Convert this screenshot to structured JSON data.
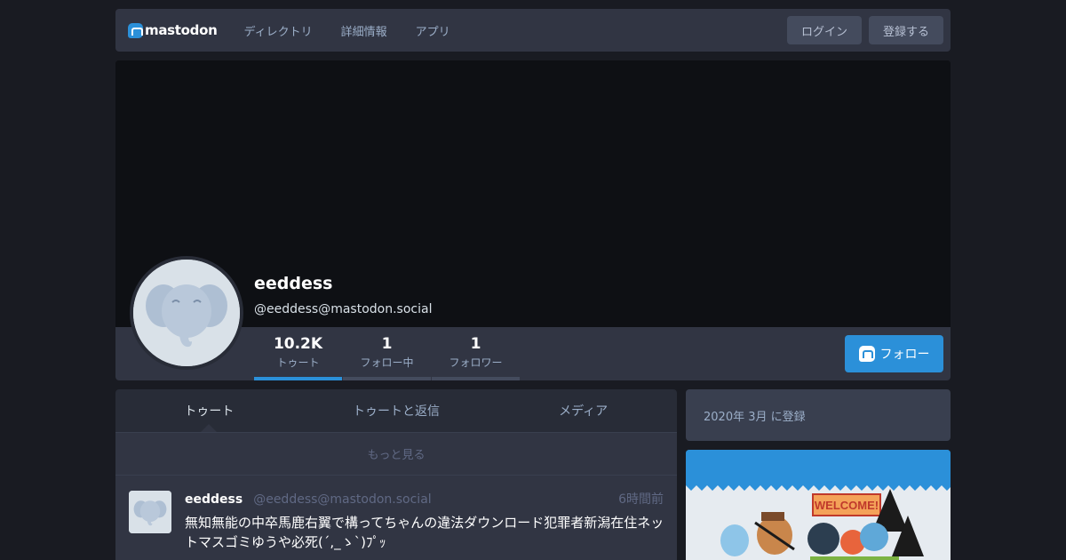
{
  "nav": {
    "logo_text": "mastodon",
    "links": [
      "ディレクトリ",
      "詳細情報",
      "アプリ"
    ],
    "login_label": "ログイン",
    "signup_label": "登録する"
  },
  "profile": {
    "display_name": "eeddess",
    "acct": "@eeddess@mastodon.social",
    "follow_label": "フォロー",
    "counters": [
      {
        "value": "10.2K",
        "label": "トゥート"
      },
      {
        "value": "1",
        "label": "フォロー中"
      },
      {
        "value": "1",
        "label": "フォロワー"
      }
    ]
  },
  "tabs": [
    "トゥート",
    "トゥートと返信",
    "メディア"
  ],
  "load_more": "もっと見る",
  "status": {
    "name": "eeddess",
    "acct": "@eeddess@mastodon.social",
    "time": "6時間前",
    "text": "無知無能の中卒馬鹿右翼で構ってちゃんの違法ダウンロード犯罪者新潟在住ネットマスゴミゆうや必死(´,_ゝ`)ﾌﾟｯ"
  },
  "sidebar": {
    "joined": "2020年 3月 に登録",
    "hero_sign": "WELCOME!"
  },
  "colors": {
    "background": "#191b22",
    "accent": "#2b90d9",
    "panel": "#313543"
  }
}
